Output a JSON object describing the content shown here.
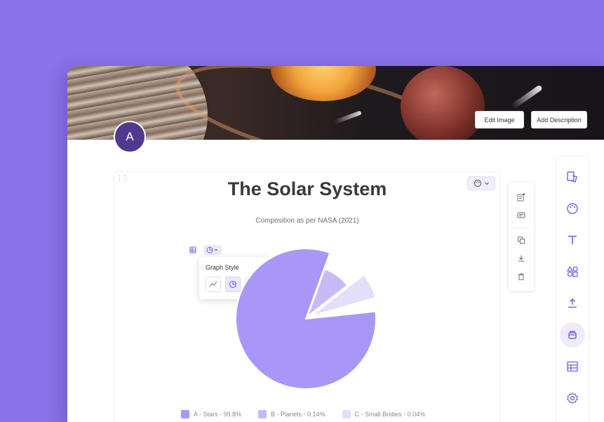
{
  "banner": {
    "edit_image_label": "Edit Image",
    "add_description_label": "Add Description"
  },
  "avatar": {
    "initial": "A"
  },
  "chart": {
    "title": "The Solar System",
    "subtitle": "Composition as per NASA (2021)"
  },
  "graph_style_popover": {
    "label": "Graph Style",
    "options": [
      "line-chart-icon",
      "pie-chart-icon",
      "bar-chart-icon"
    ],
    "selected": "pie-chart-icon"
  },
  "chart_data": {
    "type": "pie",
    "title": "The Solar System",
    "subtitle": "Composition as per NASA (2021)",
    "categories": [
      "A - Stars - 99.8%",
      "B - Planets - 0.14%",
      "C - Small Bodies - 0.04%"
    ],
    "values": [
      99.8,
      0.14,
      0.04
    ],
    "colors": [
      "#a897f7",
      "#c6bbf6",
      "#e4def9"
    ],
    "legend_position": "bottom"
  },
  "legend": [
    {
      "label": "A - Stars - 99.8%",
      "color": "#a897f7"
    },
    {
      "label": "B - Planets - 0.14%",
      "color": "#c6bbf6"
    },
    {
      "label": "C - Small Bodies - 0.04%",
      "color": "#e4def9"
    }
  ],
  "side_tools": [
    "add-note-icon",
    "comment-icon",
    "duplicate-icon",
    "download-icon",
    "delete-icon"
  ],
  "right_rail": [
    "layout-icon",
    "palette-icon",
    "text-icon",
    "shapes-icon",
    "upload-icon",
    "sticker-icon",
    "grid-layout-icon",
    "settings-icon"
  ],
  "accent_color": "#7d5fe3",
  "background_color": "#8a72ea"
}
